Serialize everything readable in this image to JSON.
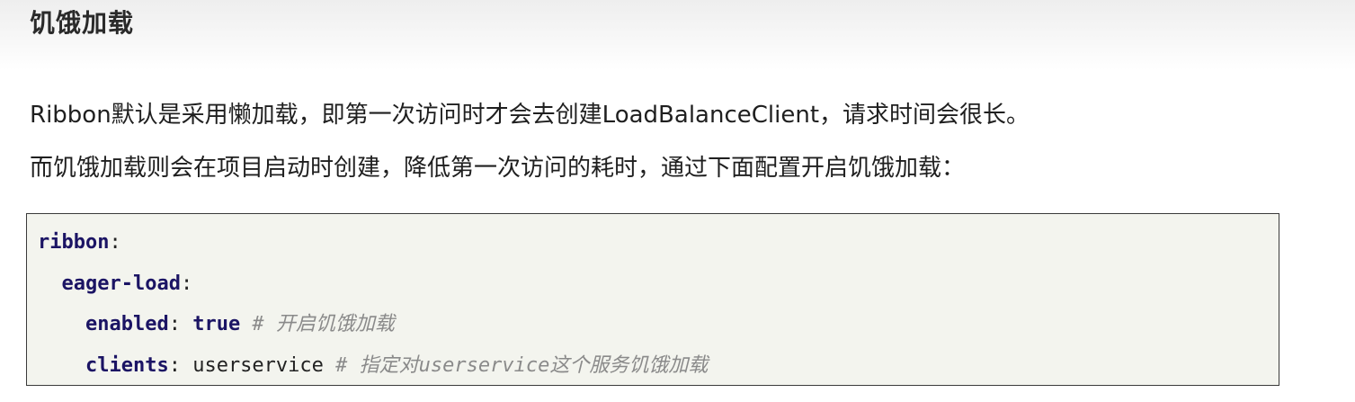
{
  "heading": "饥饿加载",
  "paragraphs": {
    "p1": "Ribbon默认是采用懒加载，即第一次访问时才会去创建LoadBalanceClient，请求时间会很长。",
    "p2": "而饥饿加载则会在项目启动时创建，降低第一次访问的耗时，通过下面配置开启饥饿加载："
  },
  "code": {
    "line1": {
      "key": "ribbon",
      "colon": ":"
    },
    "line2": {
      "indent": "  ",
      "key": "eager-load",
      "colon": ":"
    },
    "line3": {
      "indent": "    ",
      "key": "enabled",
      "colon": ": ",
      "value": "true",
      "comment": " # 开启饥饿加载"
    },
    "line4": {
      "indent": "    ",
      "key": "clients",
      "colon": ": ",
      "value": "userservice",
      "comment": " # 指定对userservice这个服务饥饿加载"
    }
  }
}
